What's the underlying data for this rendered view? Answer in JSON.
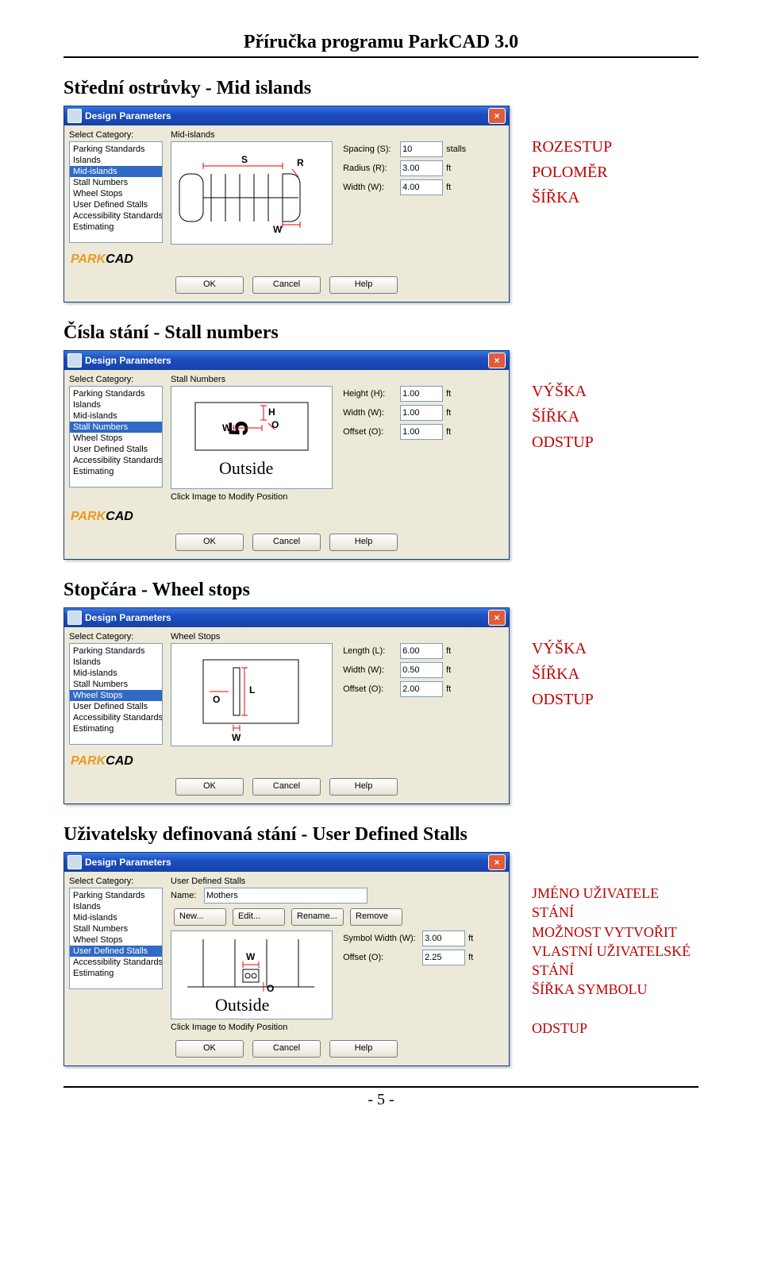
{
  "doc_header": "Příručka programu ParkCAD 3.0",
  "dialog_title": "Design Parameters",
  "select_category_label": "Select Category:",
  "categories": [
    "Parking Standards",
    "Islands",
    "Mid-islands",
    "Stall Numbers",
    "Wheel Stops",
    "User Defined Stalls",
    "Accessibility Standards",
    "Estimating"
  ],
  "buttons": {
    "ok": "OK",
    "cancel": "Cancel",
    "help": "Help"
  },
  "logo_text": "PARKCAD",
  "hint": "Click Image to Modify Position",
  "footer": "- 5 -",
  "sections": {
    "mid": {
      "title": "Střední ostrůvky - Mid islands",
      "group": "Mid-islands",
      "selected_index": 2,
      "fields": [
        {
          "label": "Spacing (S):",
          "value": "10",
          "unit": "stalls"
        },
        {
          "label": "Radius (R):",
          "value": "3.00",
          "unit": "ft"
        },
        {
          "label": "Width (W):",
          "value": "4.00",
          "unit": "ft"
        }
      ],
      "anno": [
        "ROZESTUP",
        "POLOMĚR",
        "ŠÍŘKA"
      ]
    },
    "stall": {
      "title": "Čísla stání - Stall numbers",
      "group": "Stall Numbers",
      "selected_index": 3,
      "outside": "Outside",
      "fields": [
        {
          "label": "Height (H):",
          "value": "1.00",
          "unit": "ft"
        },
        {
          "label": "Width (W):",
          "value": "1.00",
          "unit": "ft"
        },
        {
          "label": "Offset (O):",
          "value": "1.00",
          "unit": "ft"
        }
      ],
      "anno": [
        "VÝŠKA",
        "ŠÍŘKA",
        "ODSTUP"
      ]
    },
    "wheel": {
      "title": "Stopčára - Wheel stops",
      "group": "Wheel Stops",
      "selected_index": 4,
      "fields": [
        {
          "label": "Length (L):",
          "value": "6.00",
          "unit": "ft"
        },
        {
          "label": "Width (W):",
          "value": "0.50",
          "unit": "ft"
        },
        {
          "label": "Offset (O):",
          "value": "2.00",
          "unit": "ft"
        }
      ],
      "anno": [
        "VÝŠKA",
        "ŠÍŘKA",
        "ODSTUP"
      ]
    },
    "uds": {
      "title": "Uživatelsky definovaná stání - User Defined Stalls",
      "group": "User Defined Stalls",
      "selected_index": 5,
      "name_label": "Name:",
      "name_value": "Mothers",
      "outside": "Outside",
      "small_buttons": [
        "New...",
        "Edit...",
        "Rename...",
        "Remove"
      ],
      "fields": [
        {
          "label": "Symbol Width (W):",
          "value": "3.00",
          "unit": "ft"
        },
        {
          "label": "Offset (O):",
          "value": "2.25",
          "unit": "ft"
        }
      ],
      "anno": [
        "JMÉNO UŽIVATELE STÁNÍ",
        "MOŽNOST VYTVOŘIT VLASTNÍ UŽIVATELSKÉ STÁNÍ",
        "ŠÍŘKA SYMBOLU",
        "",
        "ODSTUP"
      ]
    }
  }
}
